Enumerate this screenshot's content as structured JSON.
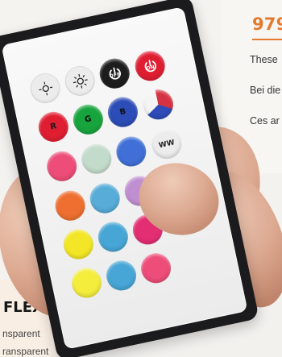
{
  "right_card": {
    "code": "979",
    "line_1": "These",
    "line_2": "Bei die",
    "line_3": "Ces ar"
  },
  "left_card": {
    "title": "FLEX",
    "sub_1": "nsparent",
    "sub_2": "ransparent"
  },
  "remote": {
    "off_label": "OFF",
    "on_label": "ON",
    "r_label": "R",
    "g_label": "G",
    "b_label": "B",
    "ww_label": "WW"
  }
}
